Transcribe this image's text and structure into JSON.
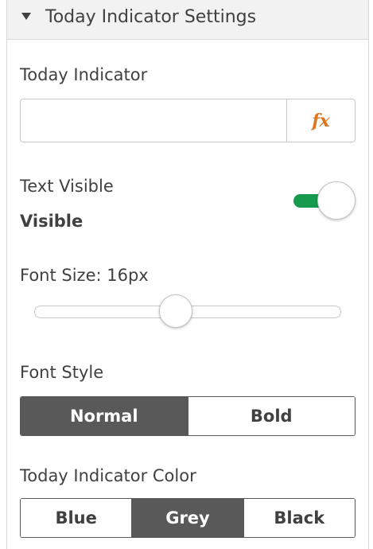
{
  "section": {
    "title": "Today Indicator Settings",
    "expanded": true
  },
  "today_indicator": {
    "label": "Today Indicator",
    "value": "",
    "fx_label": "fx"
  },
  "text_visible": {
    "label": "Text Visible",
    "state_label": "Visible",
    "on": true,
    "track_color": "#169a4e"
  },
  "font_size": {
    "label": "Font Size: 16px",
    "value": 16,
    "slider_fraction": 0.45
  },
  "font_style": {
    "label": "Font Style",
    "options": [
      "Normal",
      "Bold"
    ],
    "selected": "Normal"
  },
  "indicator_color": {
    "label": "Today Indicator Color",
    "options": [
      "Blue",
      "Grey",
      "Black"
    ],
    "selected": "Grey"
  },
  "colors": {
    "selected_segment": "#595959",
    "fx_accent": "#e0751c"
  }
}
